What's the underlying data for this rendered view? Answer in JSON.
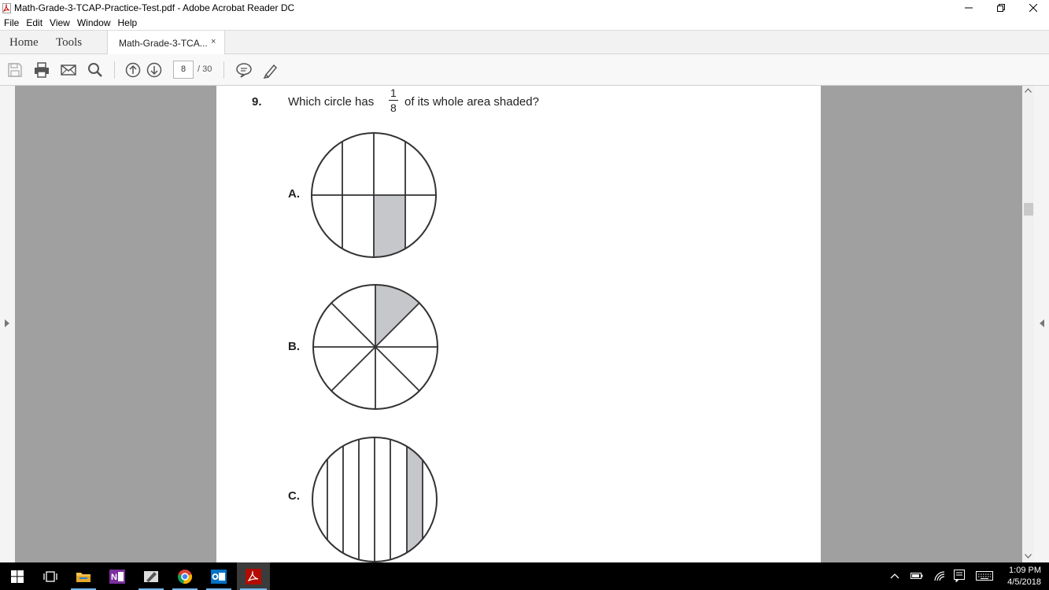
{
  "window": {
    "title": "Math-Grade-3-TCAP-Practice-Test.pdf - Adobe Acrobat Reader DC"
  },
  "menu": [
    "File",
    "Edit",
    "View",
    "Window",
    "Help"
  ],
  "tabs": {
    "home": "Home",
    "tools": "Tools",
    "document": "Math-Grade-3-TCA...",
    "close": "×"
  },
  "toolbar": {
    "page_current": "8",
    "page_total": "/ 30"
  },
  "document": {
    "question_number": "9.",
    "question_text_before": "Which circle has",
    "fraction_numerator": "1",
    "fraction_denominator": "8",
    "question_text_after": "of its whole area shaded?",
    "options": [
      {
        "label": "A.",
        "description": "circle split by 3 vertical lines and 1 horizontal line into 8 parts, one shaded"
      },
      {
        "label": "B.",
        "description": "circle split into 8 equal wedges, one shaded"
      },
      {
        "label": "C.",
        "description": "circle split by 7 vertical lines into 8 strips, one shaded"
      }
    ]
  },
  "taskbar": {
    "time": "1:09 PM",
    "date": "4/5/2018",
    "apps": [
      "windows-start",
      "task-view",
      "file-explorer",
      "onenote",
      "pen-app",
      "chrome",
      "outlook",
      "acrobat-reader"
    ]
  },
  "colors": {
    "shade": "#c6c7ca",
    "doc_background": "#a0a0a0",
    "taskbar": "#000000",
    "acrobat_red": "#b30b00"
  }
}
